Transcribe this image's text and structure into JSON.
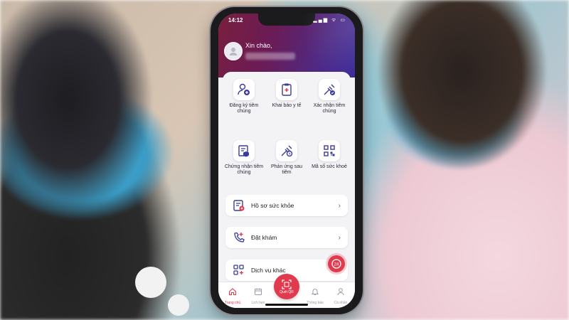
{
  "status_bar": {
    "time": "14:12",
    "icons": "▂▄▆ ᯤ ▭"
  },
  "header": {
    "greeting": "Xin chào,"
  },
  "grid": [
    {
      "label": "Đăng ký tiêm chủng",
      "icon": "user-plus-icon"
    },
    {
      "label": "Khai báo y tế",
      "icon": "clipboard-icon"
    },
    {
      "label": "Xác nhận tiêm chủng",
      "icon": "syringe-check-icon"
    },
    {
      "label": "Chứng nhận tiêm chủng",
      "icon": "certificate-icon"
    },
    {
      "label": "Phản ứng sau tiêm",
      "icon": "syringe-reaction-icon"
    },
    {
      "label": "Mã số sức khoẻ",
      "icon": "qr-code-icon"
    }
  ],
  "rows": [
    {
      "label": "Hồ sơ sức khỏe",
      "icon": "health-record-icon"
    },
    {
      "label": "Đặt khám",
      "icon": "phone-medical-icon"
    },
    {
      "label": "Dịch vụ khác",
      "icon": "grid-plus-icon"
    }
  ],
  "fab": {
    "label": "24"
  },
  "tabs": [
    {
      "label": "Trang chủ",
      "icon": "home-icon"
    },
    {
      "label": "Lịch hẹn",
      "icon": "calendar-icon"
    },
    {
      "label": "Quét QR",
      "icon": "qr-scan-icon"
    },
    {
      "label": "Thông báo",
      "icon": "bell-icon"
    },
    {
      "label": "Cá nhân",
      "icon": "person-icon"
    }
  ],
  "colors": {
    "brand": "#e03a4f",
    "header_start": "#7a1e3c",
    "header_end": "#3a2a9a",
    "icon": "#3b3b9a"
  }
}
